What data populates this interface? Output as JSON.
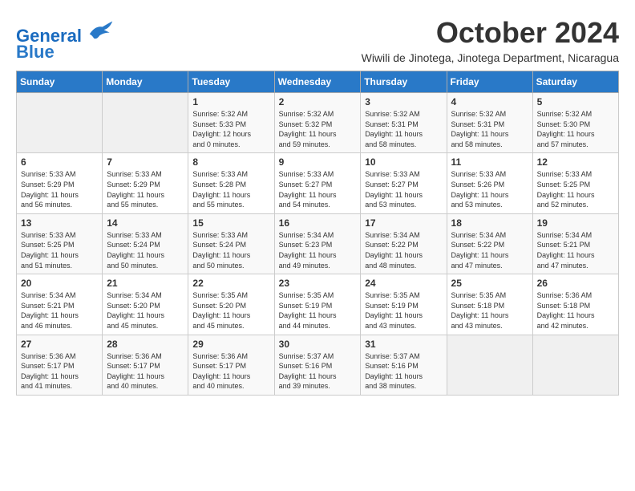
{
  "header": {
    "logo_line1": "General",
    "logo_line2": "Blue",
    "month_title": "October 2024",
    "subtitle": "Wiwili de Jinotega, Jinotega Department, Nicaragua"
  },
  "days_of_week": [
    "Sunday",
    "Monday",
    "Tuesday",
    "Wednesday",
    "Thursday",
    "Friday",
    "Saturday"
  ],
  "weeks": [
    [
      {
        "day": "",
        "info": ""
      },
      {
        "day": "",
        "info": ""
      },
      {
        "day": "1",
        "info": "Sunrise: 5:32 AM\nSunset: 5:33 PM\nDaylight: 12 hours\nand 0 minutes."
      },
      {
        "day": "2",
        "info": "Sunrise: 5:32 AM\nSunset: 5:32 PM\nDaylight: 11 hours\nand 59 minutes."
      },
      {
        "day": "3",
        "info": "Sunrise: 5:32 AM\nSunset: 5:31 PM\nDaylight: 11 hours\nand 58 minutes."
      },
      {
        "day": "4",
        "info": "Sunrise: 5:32 AM\nSunset: 5:31 PM\nDaylight: 11 hours\nand 58 minutes."
      },
      {
        "day": "5",
        "info": "Sunrise: 5:32 AM\nSunset: 5:30 PM\nDaylight: 11 hours\nand 57 minutes."
      }
    ],
    [
      {
        "day": "6",
        "info": "Sunrise: 5:33 AM\nSunset: 5:29 PM\nDaylight: 11 hours\nand 56 minutes."
      },
      {
        "day": "7",
        "info": "Sunrise: 5:33 AM\nSunset: 5:29 PM\nDaylight: 11 hours\nand 55 minutes."
      },
      {
        "day": "8",
        "info": "Sunrise: 5:33 AM\nSunset: 5:28 PM\nDaylight: 11 hours\nand 55 minutes."
      },
      {
        "day": "9",
        "info": "Sunrise: 5:33 AM\nSunset: 5:27 PM\nDaylight: 11 hours\nand 54 minutes."
      },
      {
        "day": "10",
        "info": "Sunrise: 5:33 AM\nSunset: 5:27 PM\nDaylight: 11 hours\nand 53 minutes."
      },
      {
        "day": "11",
        "info": "Sunrise: 5:33 AM\nSunset: 5:26 PM\nDaylight: 11 hours\nand 53 minutes."
      },
      {
        "day": "12",
        "info": "Sunrise: 5:33 AM\nSunset: 5:25 PM\nDaylight: 11 hours\nand 52 minutes."
      }
    ],
    [
      {
        "day": "13",
        "info": "Sunrise: 5:33 AM\nSunset: 5:25 PM\nDaylight: 11 hours\nand 51 minutes."
      },
      {
        "day": "14",
        "info": "Sunrise: 5:33 AM\nSunset: 5:24 PM\nDaylight: 11 hours\nand 50 minutes."
      },
      {
        "day": "15",
        "info": "Sunrise: 5:33 AM\nSunset: 5:24 PM\nDaylight: 11 hours\nand 50 minutes."
      },
      {
        "day": "16",
        "info": "Sunrise: 5:34 AM\nSunset: 5:23 PM\nDaylight: 11 hours\nand 49 minutes."
      },
      {
        "day": "17",
        "info": "Sunrise: 5:34 AM\nSunset: 5:22 PM\nDaylight: 11 hours\nand 48 minutes."
      },
      {
        "day": "18",
        "info": "Sunrise: 5:34 AM\nSunset: 5:22 PM\nDaylight: 11 hours\nand 47 minutes."
      },
      {
        "day": "19",
        "info": "Sunrise: 5:34 AM\nSunset: 5:21 PM\nDaylight: 11 hours\nand 47 minutes."
      }
    ],
    [
      {
        "day": "20",
        "info": "Sunrise: 5:34 AM\nSunset: 5:21 PM\nDaylight: 11 hours\nand 46 minutes."
      },
      {
        "day": "21",
        "info": "Sunrise: 5:34 AM\nSunset: 5:20 PM\nDaylight: 11 hours\nand 45 minutes."
      },
      {
        "day": "22",
        "info": "Sunrise: 5:35 AM\nSunset: 5:20 PM\nDaylight: 11 hours\nand 45 minutes."
      },
      {
        "day": "23",
        "info": "Sunrise: 5:35 AM\nSunset: 5:19 PM\nDaylight: 11 hours\nand 44 minutes."
      },
      {
        "day": "24",
        "info": "Sunrise: 5:35 AM\nSunset: 5:19 PM\nDaylight: 11 hours\nand 43 minutes."
      },
      {
        "day": "25",
        "info": "Sunrise: 5:35 AM\nSunset: 5:18 PM\nDaylight: 11 hours\nand 43 minutes."
      },
      {
        "day": "26",
        "info": "Sunrise: 5:36 AM\nSunset: 5:18 PM\nDaylight: 11 hours\nand 42 minutes."
      }
    ],
    [
      {
        "day": "27",
        "info": "Sunrise: 5:36 AM\nSunset: 5:17 PM\nDaylight: 11 hours\nand 41 minutes."
      },
      {
        "day": "28",
        "info": "Sunrise: 5:36 AM\nSunset: 5:17 PM\nDaylight: 11 hours\nand 40 minutes."
      },
      {
        "day": "29",
        "info": "Sunrise: 5:36 AM\nSunset: 5:17 PM\nDaylight: 11 hours\nand 40 minutes."
      },
      {
        "day": "30",
        "info": "Sunrise: 5:37 AM\nSunset: 5:16 PM\nDaylight: 11 hours\nand 39 minutes."
      },
      {
        "day": "31",
        "info": "Sunrise: 5:37 AM\nSunset: 5:16 PM\nDaylight: 11 hours\nand 38 minutes."
      },
      {
        "day": "",
        "info": ""
      },
      {
        "day": "",
        "info": ""
      }
    ]
  ]
}
